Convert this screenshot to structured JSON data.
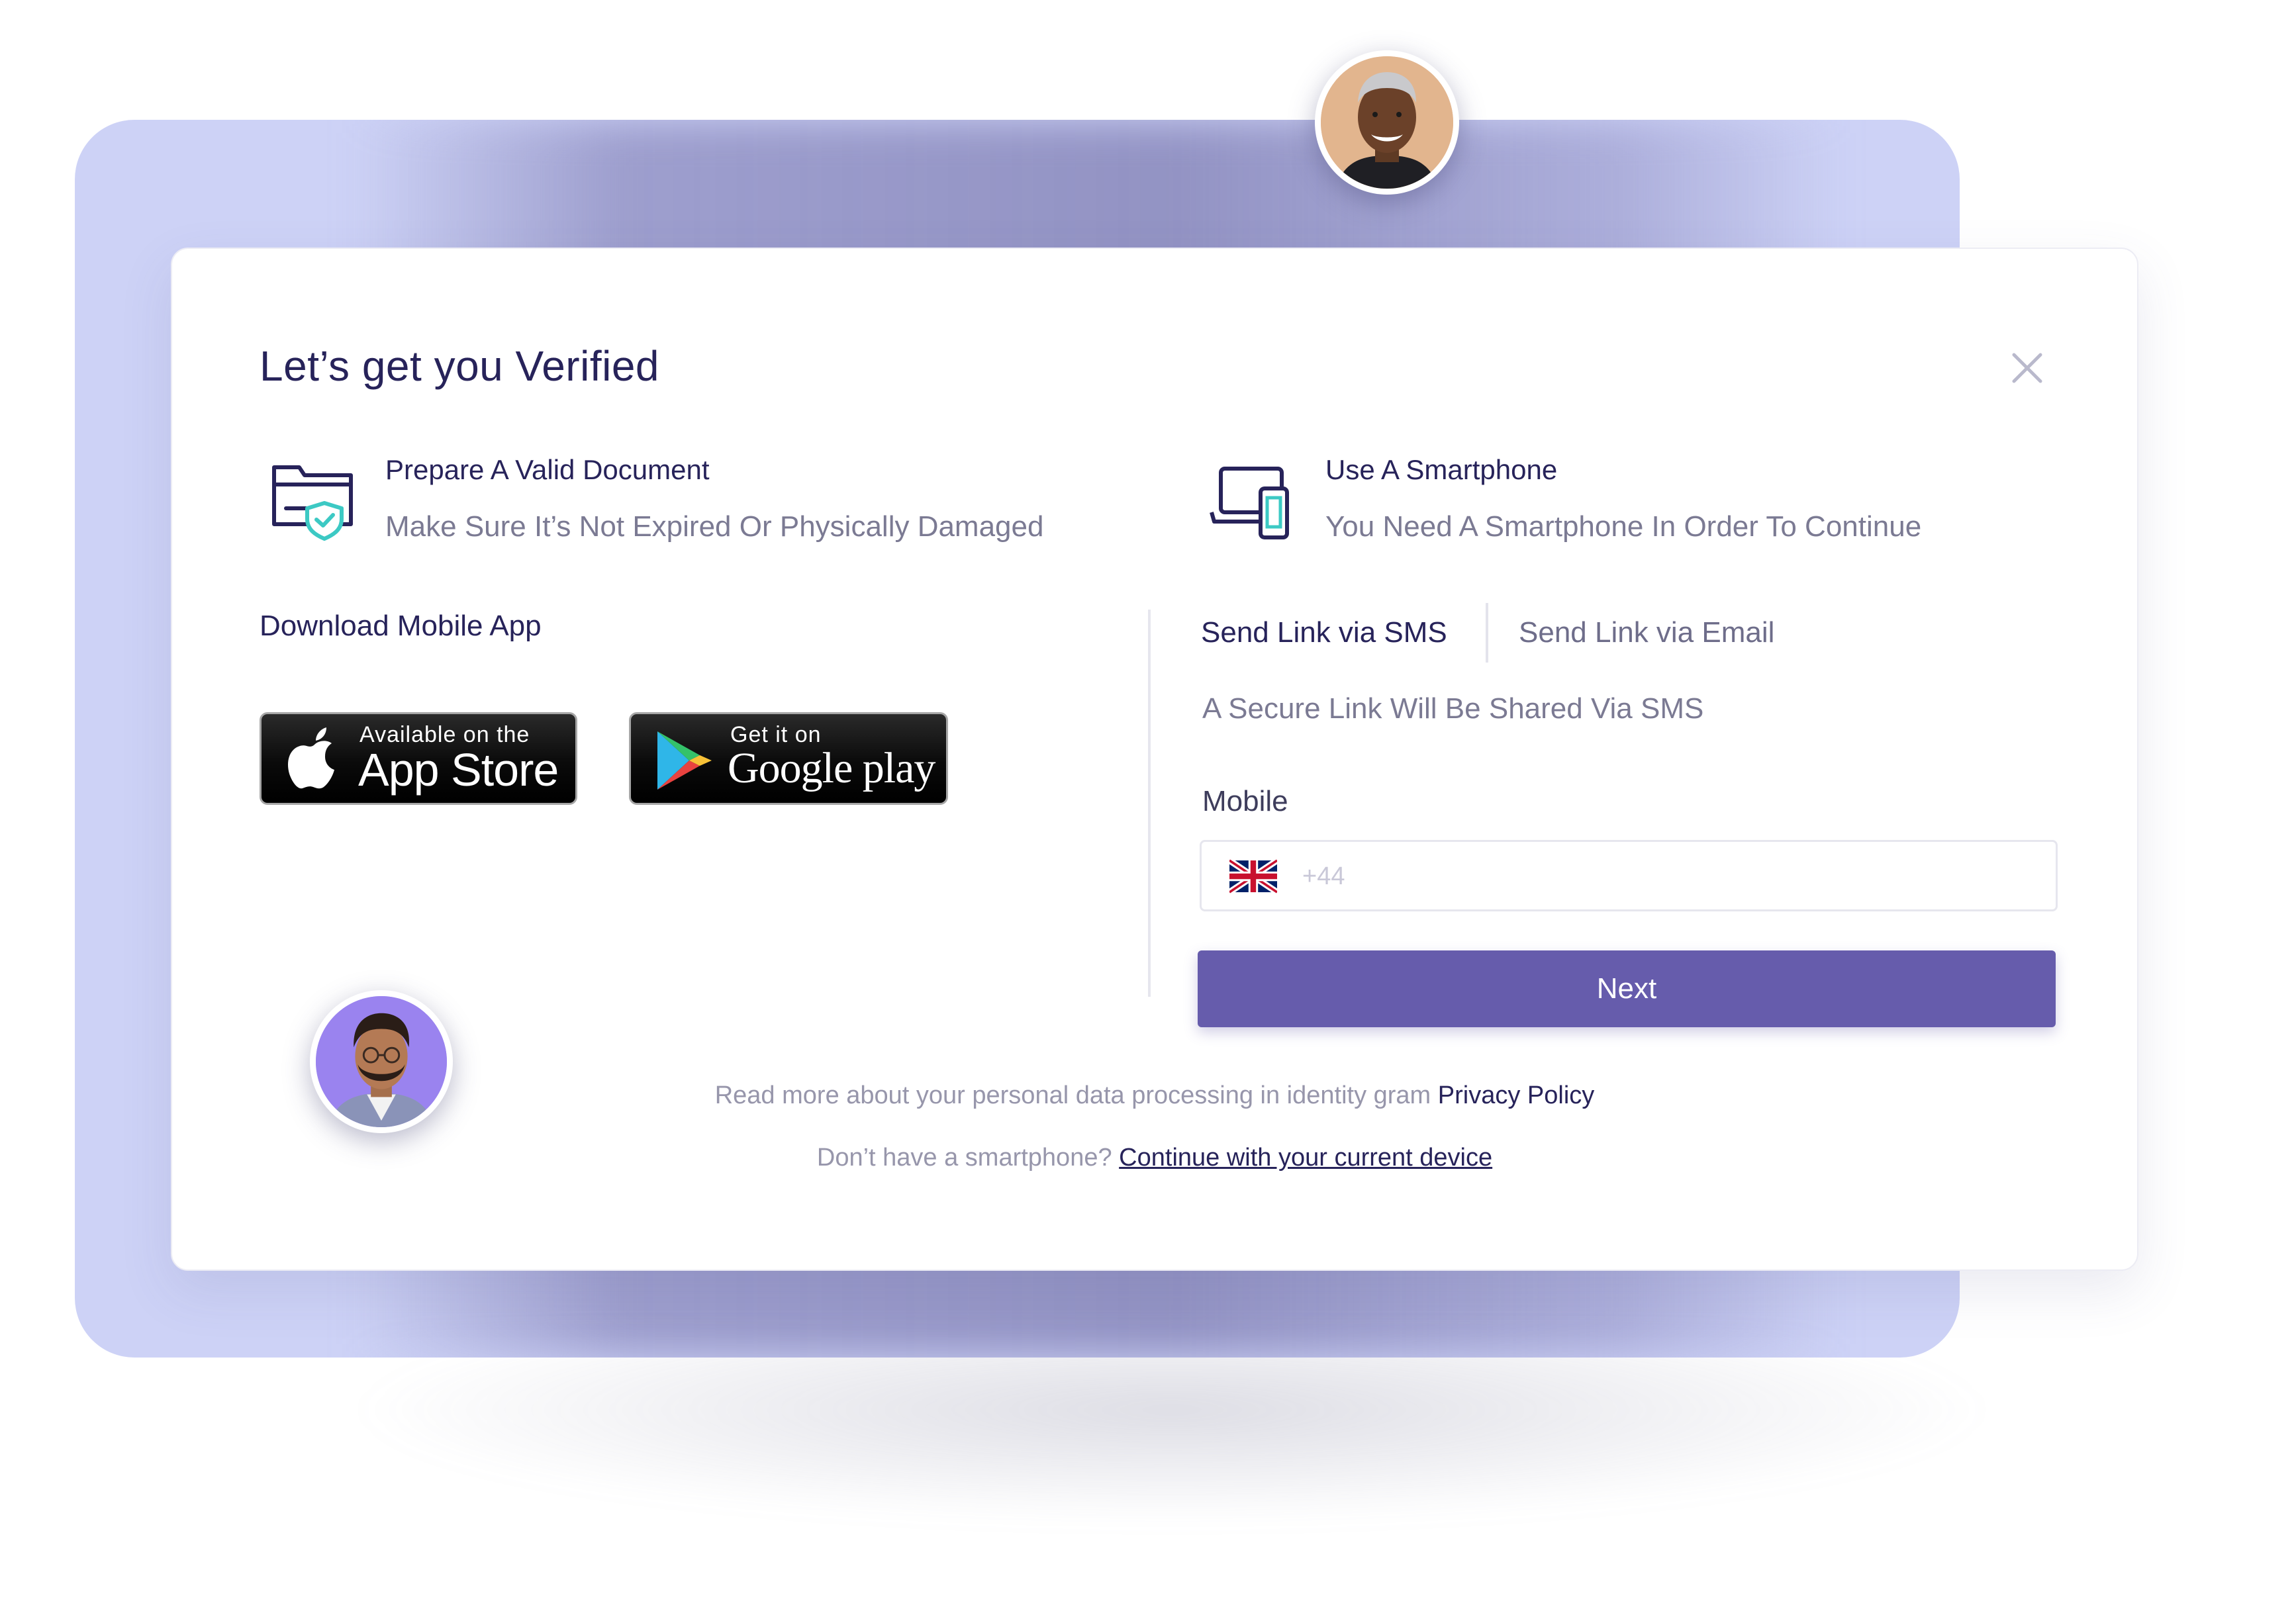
{
  "dialog": {
    "title": "Let’s get you Verified",
    "close_icon": "close-icon"
  },
  "requirements": [
    {
      "icon": "folder-shield-icon",
      "heading": "Prepare A Valid Document",
      "description": "Make Sure It’s Not Expired Or Physically Damaged"
    },
    {
      "icon": "devices-icon",
      "heading": "Use A Smartphone",
      "description": "You Need A Smartphone In Order To Continue"
    }
  ],
  "download": {
    "title": "Download Mobile App",
    "app_store": {
      "small": "Available on the",
      "big": "App Store",
      "icon": "apple-icon"
    },
    "google_play": {
      "small": "Get it on",
      "big": "Google play",
      "icon": "play-triangle-icon"
    }
  },
  "send_link": {
    "tabs": [
      {
        "label": "Send Link via SMS",
        "active": true
      },
      {
        "label": "Send Link via Email",
        "active": false
      }
    ],
    "note": "A Secure Link Will Be Shared Via SMS",
    "mobile_label": "Mobile",
    "country_flag": "uk-flag-icon",
    "phone_placeholder": "+44",
    "phone_value": "",
    "next_label": "Next"
  },
  "footer": {
    "privacy_text": "Read more about your personal data processing in identity gram",
    "privacy_link": "Privacy Policy",
    "nophone_text": "Don’t have a smartphone?",
    "nophone_link": "Continue with your current device"
  },
  "colors": {
    "primary": "#665cac",
    "heading": "#27235a",
    "muted": "#7b7a93",
    "backdrop": "#cdd2f6",
    "shield_accent": "#3cc9c4"
  }
}
